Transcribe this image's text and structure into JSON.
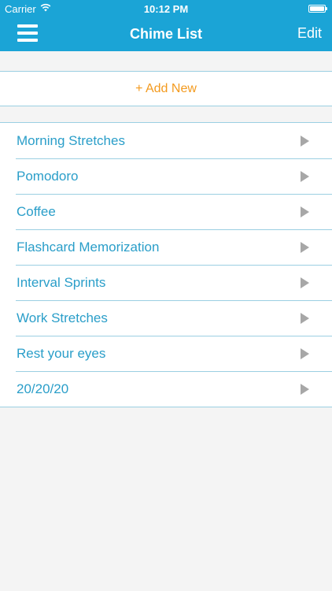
{
  "status_bar": {
    "carrier": "Carrier",
    "time": "10:12 PM"
  },
  "nav": {
    "title": "Chime List",
    "edit_label": "Edit",
    "menu_icon": "hamburger-menu-icon"
  },
  "add_new": {
    "label": "+ Add New"
  },
  "chimes": [
    {
      "label": "Morning Stretches"
    },
    {
      "label": "Pomodoro"
    },
    {
      "label": "Coffee"
    },
    {
      "label": "Flashcard Memorization"
    },
    {
      "label": "Interval Sprints"
    },
    {
      "label": "Work Stretches"
    },
    {
      "label": "Rest your eyes"
    },
    {
      "label": "20/20/20"
    }
  ],
  "colors": {
    "nav_background": "#1ba4d6",
    "accent_text": "#2a9ec9",
    "add_new_text": "#f39a1e",
    "page_background": "#f4f4f4",
    "separator": "#9bcfe2"
  }
}
